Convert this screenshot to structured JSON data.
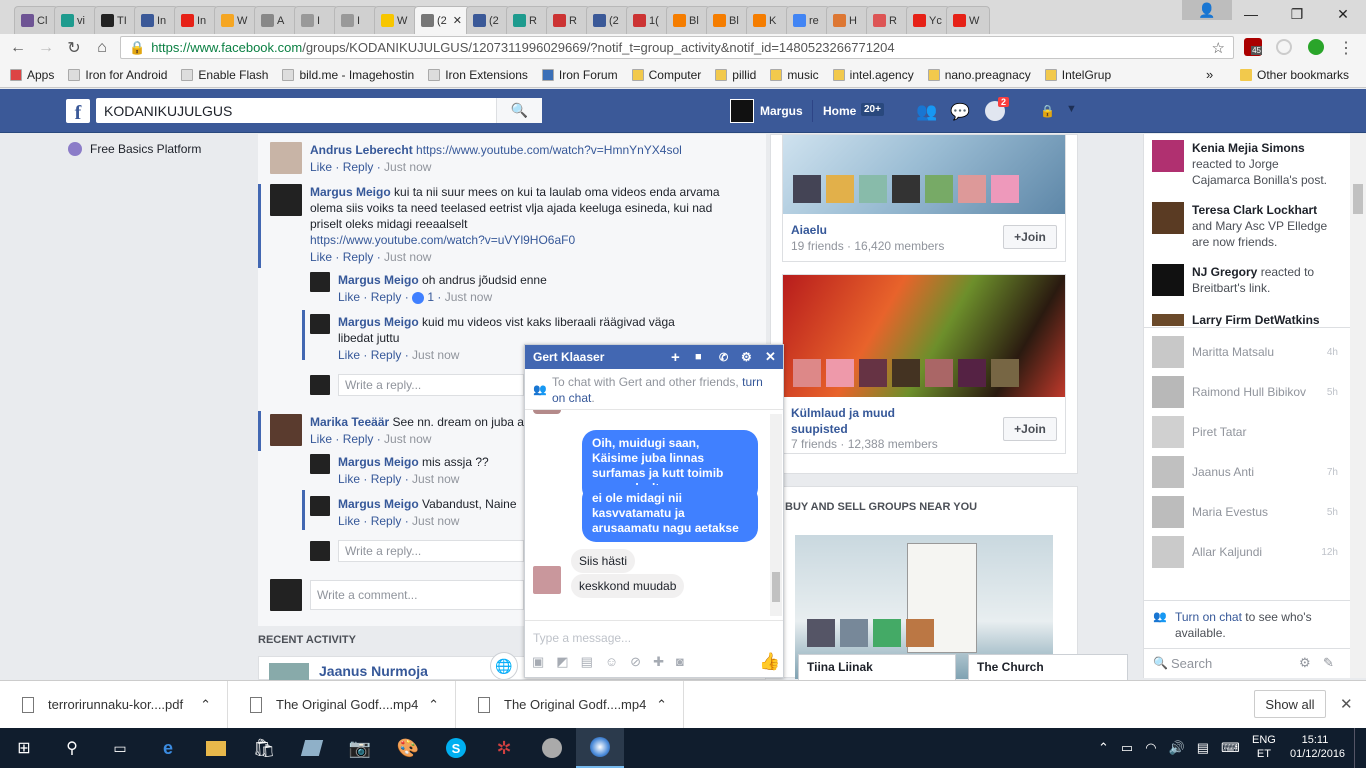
{
  "browser": {
    "tabs": [
      {
        "label": "Cl",
        "color": "#6e5494"
      },
      {
        "label": "vi",
        "color": "#1e9b8e"
      },
      {
        "label": "TI",
        "color": "#222222"
      },
      {
        "label": "In",
        "color": "#3b5998"
      },
      {
        "label": "In",
        "color": "#e62117"
      },
      {
        "label": "W",
        "color": "#f5a623"
      },
      {
        "label": "A",
        "color": "#888888"
      },
      {
        "label": "I",
        "color": "#999999"
      },
      {
        "label": "I",
        "color": "#999999"
      },
      {
        "label": "W",
        "color": "#f7c600"
      },
      {
        "label": "(2",
        "color": "#777777",
        "active": true
      },
      {
        "label": "(2",
        "color": "#3b5998"
      },
      {
        "label": "R",
        "color": "#1e9b8e"
      },
      {
        "label": "R",
        "color": "#cc3333"
      },
      {
        "label": "(2",
        "color": "#3b5998"
      },
      {
        "label": "1(",
        "color": "#cc3333"
      },
      {
        "label": "Bl",
        "color": "#f57d00"
      },
      {
        "label": "Bl",
        "color": "#f57d00"
      },
      {
        "label": "K",
        "color": "#f57d00"
      },
      {
        "label": "re",
        "color": "#4285f4"
      },
      {
        "label": "H",
        "color": "#dd7733"
      },
      {
        "label": "R",
        "color": "#dd5555"
      },
      {
        "label": "Yc",
        "color": "#e62117"
      },
      {
        "label": "W",
        "color": "#e62117"
      }
    ],
    "window_controls": {
      "minimize": "—",
      "restore": "❐",
      "close": "✕"
    },
    "nav": {
      "back": "←",
      "forward": "→",
      "reload": "↻",
      "home": "⌂"
    },
    "url_host": "https://www.facebook.com",
    "url_path": "/groups/KODANIKUJULGUS/1207311996029669/?notif_t=group_activity&notif_id=1480523266771204",
    "star": "☆",
    "extension_badge": "45",
    "bookmarks": [
      {
        "label": "Apps",
        "color": "#d44"
      },
      {
        "label": "Iron for Android",
        "color": "#ddd"
      },
      {
        "label": "Enable Flash",
        "color": "#ddd"
      },
      {
        "label": "bild.me - Imagehostin",
        "color": "#ddd"
      },
      {
        "label": "Iron Extensions",
        "color": "#ddd"
      },
      {
        "label": "Iron Forum",
        "color": "#3a6fb7"
      },
      {
        "label": "Computer",
        "color": "#f2c94c"
      },
      {
        "label": "pillid",
        "color": "#f2c94c"
      },
      {
        "label": "music",
        "color": "#f2c94c"
      },
      {
        "label": "intel.agency",
        "color": "#f2c94c"
      },
      {
        "label": "nano.preagnacy",
        "color": "#f2c94c"
      },
      {
        "label": "IntelGrup",
        "color": "#f2c94c"
      }
    ],
    "bookmarks_more": "»",
    "other_bookmarks": "Other bookmarks"
  },
  "fb": {
    "search_value": "KODANIKUJULGUS",
    "user": "Margus",
    "home": "Home",
    "home_badge": "20+",
    "notif_badge": "2",
    "left_link": "Free Basics Platform",
    "comments": [
      {
        "name": "Andrus Leberecht",
        "text": "",
        "link": "https://www.youtube.com/watch?v=HmnYnYX4sol",
        "like": "Like",
        "reply": "Reply",
        "time": "Just now"
      },
      {
        "name": "Margus Meigo",
        "text": "kui ta nii suur mees on kui ta laulab oma videos enda arvama olema siis voiks ta need teelased eetrist vlja ajada keeluga esineda, kui nad priselt oleks midagi reeaalselt",
        "link": "https://www.youtube.com/watch?v=uVYl9HO6aF0",
        "like": "Like",
        "reply": "Reply",
        "time": "Just now"
      },
      {
        "name": "Margus Meigo",
        "text": "oh andrus jõudsid enne",
        "like": "Like",
        "reply": "Reply",
        "likes": "1",
        "time": "Just now"
      },
      {
        "name": "Margus Meigo",
        "text": "kuid mu videos vist kaks liberaali räägivad väga libedat juttu",
        "like": "Like",
        "reply": "Reply",
        "time": "Just now"
      },
      {
        "name": "Marika Teeäär",
        "text": "See nn. dream on juba a",
        "like": "Like",
        "reply": "Reply",
        "time": "Just now"
      },
      {
        "name": "Margus Meigo",
        "text": "mis assja ??",
        "like": "Like",
        "reply": "Reply",
        "time": "Just now"
      },
      {
        "name": "Margus Meigo",
        "text": "Vabandust, Naine",
        "like": "Like",
        "reply": "Reply",
        "time": "Just now"
      }
    ],
    "write_reply": "Write a reply...",
    "write_comment": "Write a comment...",
    "recent_activity": "RECENT ACTIVITY",
    "recent_name": "Jaanus Nurmoja",
    "groups": [
      {
        "name": "Aiaelu",
        "meta": "19 friends · 16,420 members",
        "join": "Join"
      },
      {
        "name": "Külmlaud ja muud suupisted",
        "meta": "7 friends · 12,388 members",
        "join": "Join"
      }
    ],
    "buy_sell_title": "BUY AND SELL GROUPS NEAR YOU",
    "chat": {
      "title": "Gert Klaaser",
      "notice_pre": "To chat with Gert and other friends, ",
      "notice_link": "turn on chat",
      "notice_post": ".",
      "out1": "Oih, muidugi saan, Käisime juba linnas surfamas ja kutt toimib normaalselt",
      "out2": "ei ole midagi nii kasvvatamatu ja arusaamatu nagu aetakse",
      "in1": "Siis hästi",
      "in2": "keskkond muudab",
      "placeholder": "Type a message..."
    },
    "minimized_chats": [
      "Tiina Liinak",
      "The Church"
    ],
    "ticker": [
      {
        "name": "Kenia Mejia Simons",
        "text": "reacted to Jorge Cajamarca Bonilla's post."
      },
      {
        "name": "Teresa Clark Lockhart",
        "text": "and Mary Asc VP Elledge are now friends."
      },
      {
        "name": "NJ Gregory",
        "text": "reacted to Breitbart's link."
      },
      {
        "name": "Larry Firm DetWatkins",
        "text": ""
      }
    ],
    "friends": [
      {
        "name": "Maritta Matsalu",
        "ago": "4h"
      },
      {
        "name": "Raimond Hull Bibikov",
        "ago": "5h"
      },
      {
        "name": "Piret Tatar",
        "ago": ""
      },
      {
        "name": "Jaanus Anti",
        "ago": "7h"
      },
      {
        "name": "Maria Evestus",
        "ago": "5h"
      },
      {
        "name": "Allar Kaljundi",
        "ago": "12h"
      }
    ],
    "sidebar_chat_link": "Turn on chat",
    "sidebar_chat_text": " to see who's available.",
    "sidebar_search": "Search"
  },
  "downloads": {
    "items": [
      "terrorirunnaku-kor....pdf",
      "The Original Godf....mp4",
      "The Original Godf....mp4"
    ],
    "show_all": "Show all"
  },
  "taskbar": {
    "lang": "ENG",
    "lang2": "ET",
    "time": "15:11",
    "date": "01/12/2016"
  }
}
